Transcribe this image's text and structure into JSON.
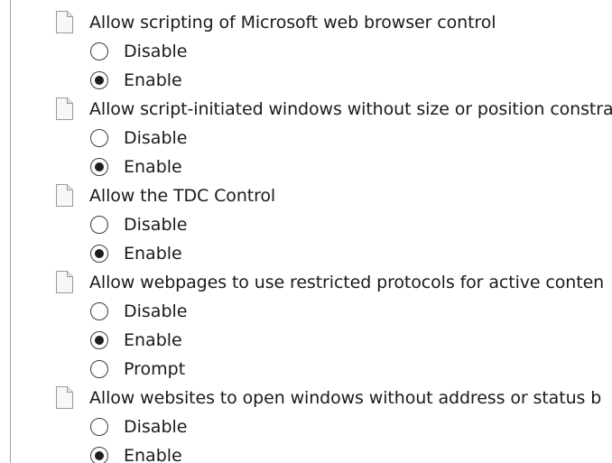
{
  "settings": [
    {
      "label": "Allow scripting of Microsoft web browser control",
      "options": [
        {
          "label": "Disable",
          "checked": false
        },
        {
          "label": "Enable",
          "checked": true
        }
      ]
    },
    {
      "label": "Allow script-initiated windows without size or position constra",
      "options": [
        {
          "label": "Disable",
          "checked": false
        },
        {
          "label": "Enable",
          "checked": true
        }
      ]
    },
    {
      "label": "Allow the TDC Control",
      "options": [
        {
          "label": "Disable",
          "checked": false
        },
        {
          "label": "Enable",
          "checked": true
        }
      ]
    },
    {
      "label": "Allow webpages to use restricted protocols for active conten",
      "options": [
        {
          "label": "Disable",
          "checked": false
        },
        {
          "label": "Enable",
          "checked": true
        },
        {
          "label": "Prompt",
          "checked": false
        }
      ]
    },
    {
      "label": "Allow websites to open windows without address or status b",
      "options": [
        {
          "label": "Disable",
          "checked": false
        },
        {
          "label": "Enable",
          "checked": true
        }
      ]
    }
  ]
}
